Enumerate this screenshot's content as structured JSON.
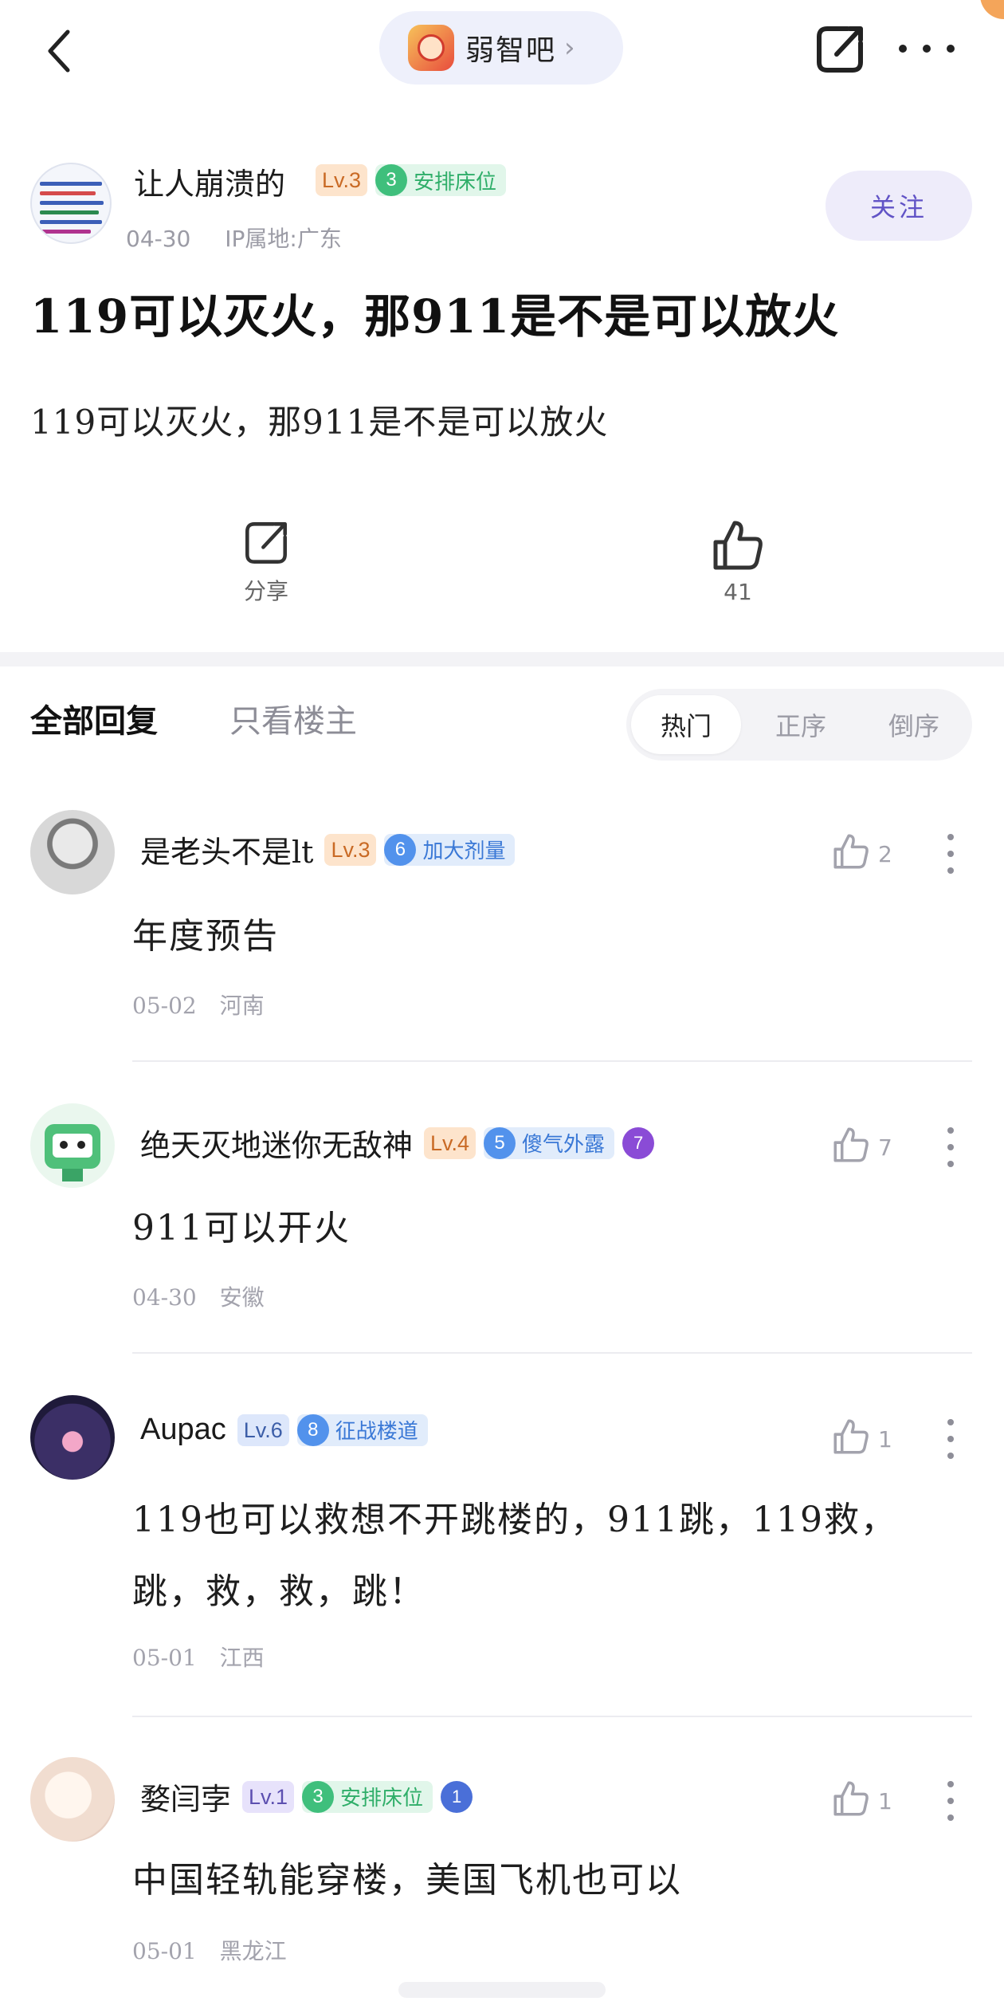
{
  "topbar": {
    "forum_name": "弱智吧",
    "chevron": "›",
    "icons": [
      "back-icon",
      "share-icon",
      "more-icon"
    ]
  },
  "author": {
    "name": "让人崩溃的",
    "level": "Lv.3",
    "title_num": "3",
    "title": "安排床位",
    "date": "04-30",
    "ip": "IP属地:广东",
    "follow_label": "关注"
  },
  "post": {
    "title": "119可以灭火，那911是不是可以放火",
    "body": "119可以灭火，那911是不是可以放火",
    "share_label": "分享",
    "like_count": "41"
  },
  "tabs": {
    "all": "全部回复",
    "op_only": "只看楼主",
    "sort": [
      "热门",
      "正序",
      "倒序"
    ],
    "active_sort": "热门"
  },
  "comments": [
    {
      "name": "是老头不是lt",
      "level": "Lv.3",
      "title_num": "6",
      "title": "加大剂量",
      "likes": "2",
      "lines": [
        "年度预告"
      ],
      "date": "05-02",
      "location": "河南"
    },
    {
      "name": "绝天灭地迷你无敌神",
      "level": "Lv.4",
      "title_num": "5",
      "title": "傻气外露",
      "medal": "7",
      "likes": "7",
      "lines": [
        "911可以开火"
      ],
      "date": "04-30",
      "location": "安徽"
    },
    {
      "name": "Aupac",
      "level": "Lv.6",
      "title_num": "8",
      "title": "征战楼道",
      "likes": "1",
      "lines": [
        "119也可以救想不开跳楼的，911跳，119救，",
        "跳，救，救，跳！"
      ],
      "date": "05-01",
      "location": "江西"
    },
    {
      "name": "婺闫孛",
      "level": "Lv.1",
      "title_num": "3",
      "title": "安排床位",
      "medal": "1",
      "likes": "1",
      "lines": [
        "中国轻轨能穿楼，美国飞机也可以"
      ],
      "date": "05-01",
      "location": "黑龙江"
    }
  ]
}
